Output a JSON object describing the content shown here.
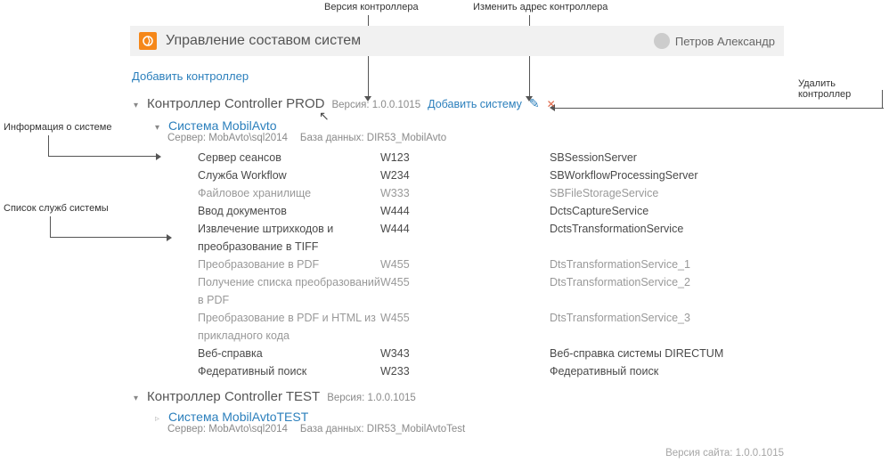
{
  "annotations": {
    "version": "Версия контроллера",
    "edit_addr": "Изменить адрес контроллера",
    "delete": "Удалить контроллер",
    "sys_info": "Информация о системе",
    "services_list": "Список служб системы"
  },
  "header": {
    "title": "Управление составом систем",
    "user": "Петров Александр"
  },
  "add_controller": "Добавить контроллер",
  "controllers": [
    {
      "name": "Контроллер Controller PROD",
      "version_label": "Версия: 1.0.0.1015",
      "add_system": "Добавить систему",
      "expanded": true,
      "systems": [
        {
          "name": "Система MobilAvto",
          "server_label": "Сервер: MobAvto\\sql2014",
          "db_label": "База данных: DIR53_MobilAvto",
          "expanded": true,
          "services": [
            {
              "name": "Сервер сеансов",
              "code": "W123",
              "id": "SBSessionServer",
              "dim": false
            },
            {
              "name": "Служба Workflow",
              "code": "W234",
              "id": "SBWorkflowProcessingServer",
              "dim": false
            },
            {
              "name": "Файловое хранилище",
              "code": "W333",
              "id": "SBFileStorageService",
              "dim": true
            },
            {
              "name": "Ввод документов",
              "code": "W444",
              "id": "DctsCaptureService",
              "dim": false
            },
            {
              "name": "Извлечение штрихкодов и преобразование в TIFF",
              "code": "W444",
              "id": "DctsTransformationService",
              "dim": false
            },
            {
              "name": "Преобразование в PDF",
              "code": "W455",
              "id": "DtsTransformationService_1",
              "dim": true
            },
            {
              "name": "Получение списка преобразований в PDF",
              "code": "W455",
              "id": "DtsTransformationService_2",
              "dim": true
            },
            {
              "name": "Преобразование в PDF и HTML из прикладного кода",
              "code": "W455",
              "id": "DtsTransformationService_3",
              "dim": true
            },
            {
              "name": "Веб-справка",
              "code": "W343",
              "id": "Веб-справка системы DIRECTUM",
              "dim": false
            },
            {
              "name": "Федеративный поиск",
              "code": "W233",
              "id": "Федеративный поиск",
              "dim": false
            }
          ]
        }
      ]
    },
    {
      "name": "Контроллер Controller TEST",
      "version_label": "Версия: 1.0.0.1015",
      "expanded": true,
      "systems": [
        {
          "name": "Система MobilAvtoTEST",
          "server_label": "Сервер: MobAvto\\sql2014",
          "db_label": "База данных: DIR53_MobilAvtoTest",
          "expanded": false
        }
      ]
    }
  ],
  "site_version": "Версия сайта: 1.0.0.1015"
}
